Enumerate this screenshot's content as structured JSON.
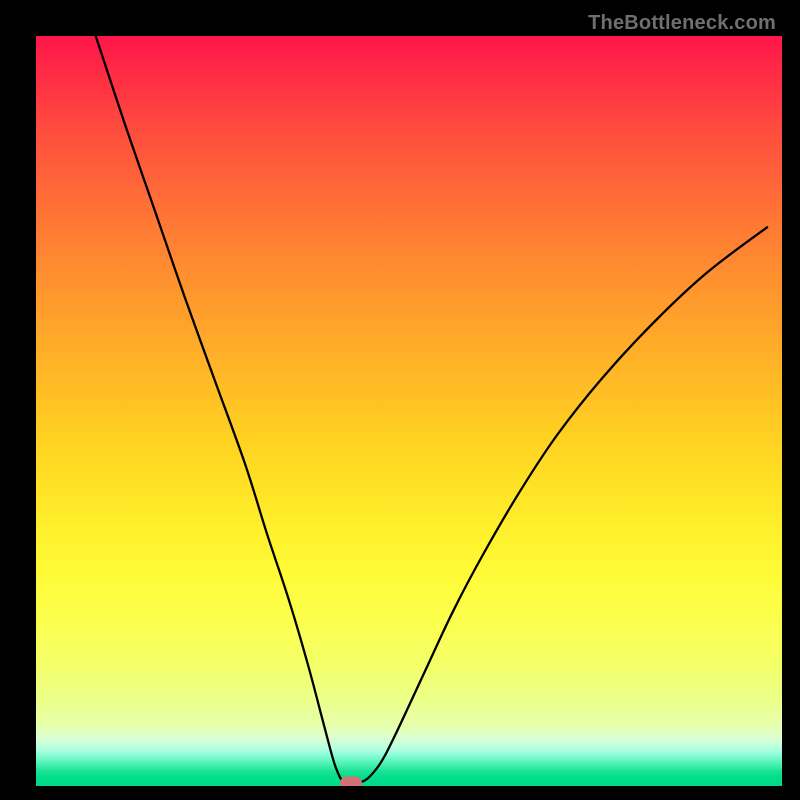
{
  "watermark": "TheBottleneck.com",
  "chart_data": {
    "type": "line",
    "title": "",
    "xlabel": "",
    "ylabel": "",
    "xlim": [
      0,
      100
    ],
    "ylim": [
      0,
      100
    ],
    "series": [
      {
        "name": "bottleneck-curve",
        "x": [
          8,
          12,
          16,
          20,
          24,
          28,
          31,
          34,
          36.5,
          38.5,
          40,
          41,
          41.5,
          42,
          44,
          46,
          48,
          52,
          56,
          60,
          65,
          70,
          76,
          83,
          90,
          98
        ],
        "y": [
          100,
          88,
          76.5,
          65,
          54,
          43,
          33.5,
          24.5,
          16,
          8.5,
          3,
          0.7,
          0.5,
          0.6,
          0.7,
          2.8,
          6.5,
          15,
          23.5,
          31,
          39.5,
          47,
          54.5,
          62,
          68.5,
          74.5
        ]
      }
    ],
    "annotations": [
      {
        "name": "optimal-point",
        "x": 42.2,
        "y": 0.4
      }
    ],
    "background_gradient": {
      "top": "#ff164a",
      "mid": "#fff02c",
      "bottom": "#00da85"
    }
  }
}
